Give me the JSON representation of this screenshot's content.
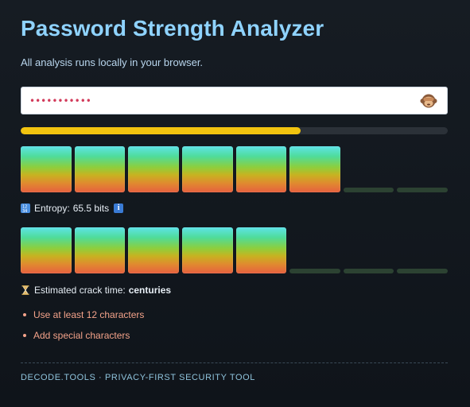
{
  "header": {
    "title": "Password Strength Analyzer",
    "subtitle": "All analysis runs locally in your browser."
  },
  "password_field": {
    "masked_value": "•••••••••••",
    "visibility_toggle_icon": "see-no-evil-monkey-icon"
  },
  "strength_bar": {
    "fraction": 0.656,
    "color": "#f2c40f"
  },
  "entropy": {
    "icon": "numbers-icon",
    "label": "Entropy:",
    "value": "65.5 bits",
    "info_icon": "info-icon",
    "segments_total": 8,
    "segments_filled": 6
  },
  "crack_time": {
    "icon": "hourglass-icon",
    "label": "Estimated crack time:",
    "value": "centuries",
    "segments_total": 8,
    "segments_filled": 5
  },
  "suggestions": [
    "Use at least 12 characters",
    "Add special characters"
  ],
  "footer": {
    "text": "DECODE.TOOLS · PRIVACY-FIRST SECURITY TOOL"
  },
  "colors": {
    "title": "#8fd3ff",
    "suggestion": "#f4a38a",
    "segment_off": "#2c4232"
  }
}
